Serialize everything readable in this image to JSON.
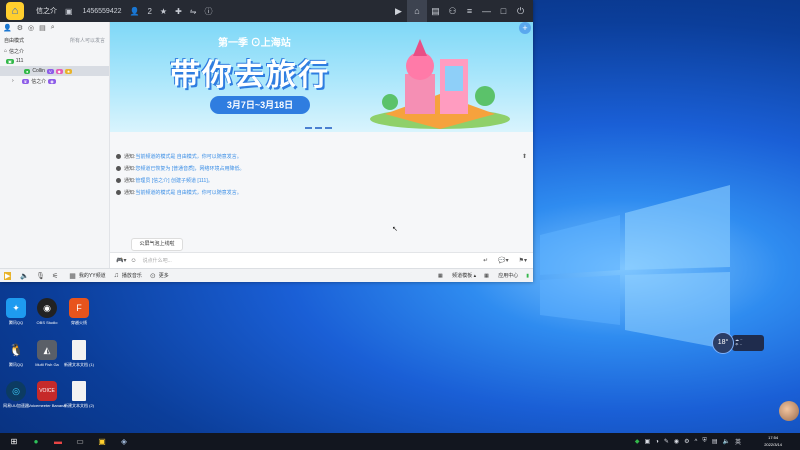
{
  "app": {
    "logo": "home-logo-icon",
    "channel_name": "信之介",
    "channel_id": "1456559422",
    "user_count": "2",
    "right_icons": [
      "video-icon",
      "home-icon",
      "list-icon",
      "game-icon",
      "menu-icon",
      "minimize-icon",
      "maximize-icon",
      "power-icon"
    ]
  },
  "sidebar": {
    "mode_label": "自由模式",
    "mode_right": "所有人可以发言",
    "tree": [
      {
        "label": "信之介",
        "indent": 0
      },
      {
        "label": "111",
        "indent": 0
      },
      {
        "label": "Collin",
        "indent": 1,
        "selected": true
      },
      {
        "label": "信之介",
        "indent": 1
      }
    ]
  },
  "banner": {
    "season": "第一季 ⊙上海站",
    "title": "带你去旅行",
    "date": "3月7日~3月18日",
    "colors": {
      "sky": "#7fd8f7",
      "accent": "#2f7de0"
    }
  },
  "messages": [
    {
      "label": "通知:",
      "text": "当前频道的模式是 自由模式，你可以随意发言。"
    },
    {
      "label": "通知:",
      "text": "您频道已恢复为 [普通音质]，网络环境占用降低。"
    },
    {
      "label": "通知:",
      "text": "管理员 [信之介] 创建子频道 [111]。"
    },
    {
      "label": "通知:",
      "text": "当前频道的模式是 自由模式，你可以随意发言。"
    }
  ],
  "mic_tip": "公屏气泡上线啦",
  "input": {
    "placeholder": "说点什么吧..."
  },
  "bottombar": {
    "items": [
      "我的YY频道",
      "播放音乐",
      "更多"
    ],
    "right_items": [
      "频道模板",
      "应用中心"
    ]
  },
  "desktop_icons": [
    {
      "label": "腾讯QQ",
      "name": "qq-icon"
    },
    {
      "label": "OBS Studio",
      "name": "obs-icon"
    },
    {
      "label": "穿越火线",
      "name": "cf-icon"
    },
    {
      "label": "腾讯QQ",
      "name": "qq-penguin-icon"
    },
    {
      "label": "Multi Fish Ga",
      "name": "game-icon"
    },
    {
      "label": "新建文本文档 (1)",
      "name": "text-file-icon"
    },
    {
      "label": "网易UU加速器",
      "name": "uu-icon"
    },
    {
      "label": "Voicemeeter Banana",
      "name": "voicemeeter-icon"
    },
    {
      "label": "新建文本文档 (2)",
      "name": "text-file-icon"
    }
  ],
  "weather": {
    "temp": "18°"
  },
  "taskbar": {
    "time": "17:54",
    "date": "2022/3/14"
  }
}
